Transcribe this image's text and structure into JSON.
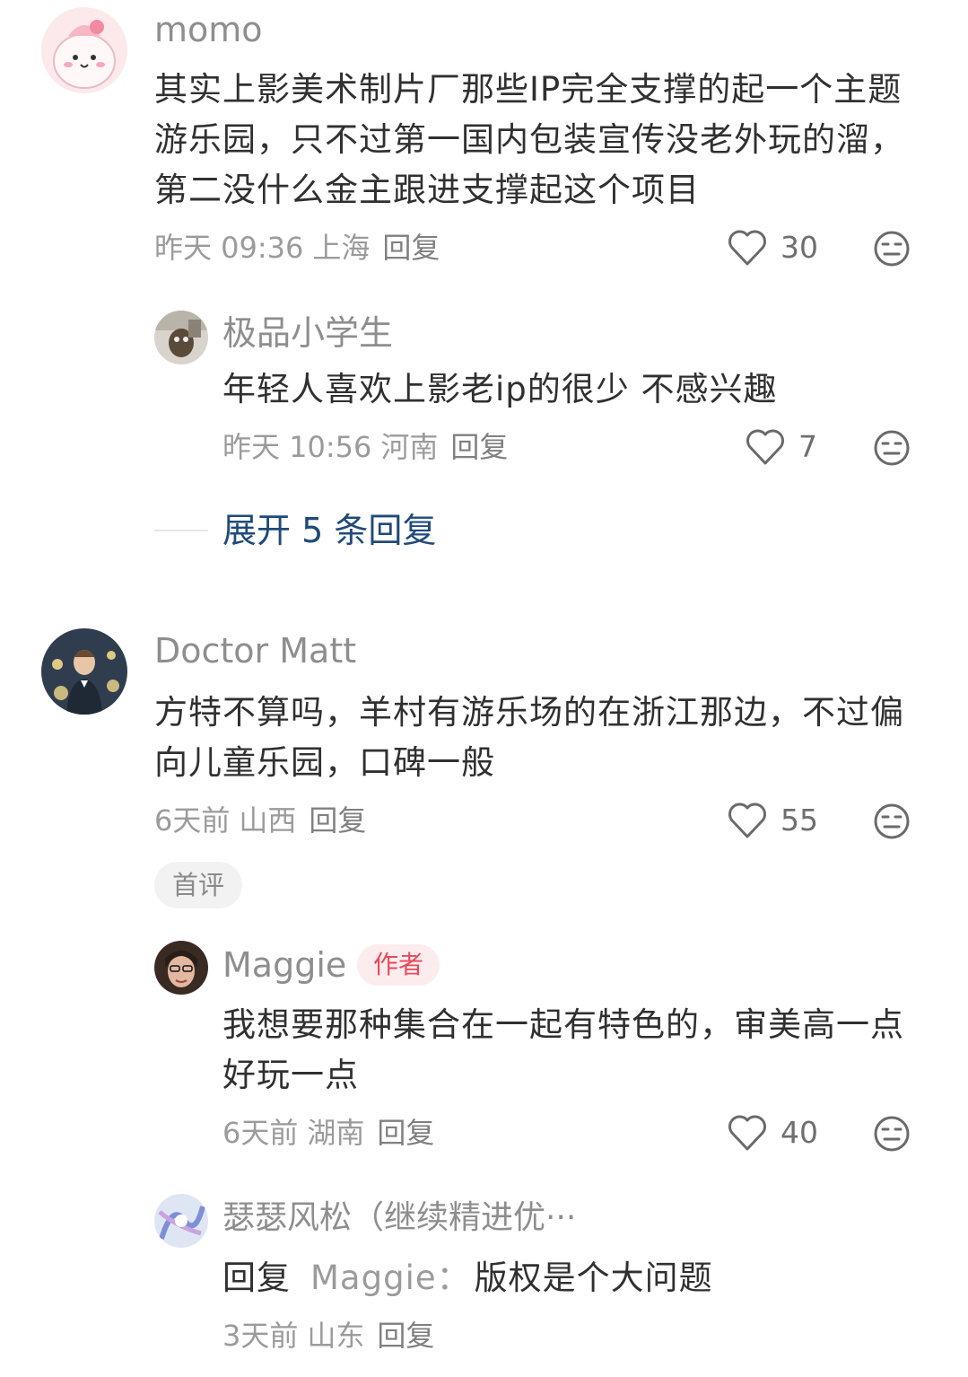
{
  "comments": [
    {
      "username": "momo",
      "text": "其实上影美术制片厂那些IP完全支撑的起一个主题游乐园，只不过第一国内包装宣传没老外玩的溜，第二没什么金主跟进支撑起这个项目",
      "time": "昨天 09:36",
      "location": "上海",
      "reply_label": "回复",
      "likes": "30",
      "replies": [
        {
          "username": "极品小学生",
          "text": "年轻人喜欢上影老ip的很少 不感兴趣",
          "time": "昨天 10:56",
          "location": "河南",
          "reply_label": "回复",
          "likes": "7"
        }
      ],
      "expand_label": "展开 5 条回复"
    },
    {
      "username": "Doctor Matt",
      "text": "方特不算吗，羊村有游乐场的在浙江那边，不过偏向儿童乐园，口碑一般",
      "time": "6天前",
      "location": "山西",
      "reply_label": "回复",
      "likes": "55",
      "tag": "首评",
      "replies": [
        {
          "username": "Maggie",
          "badge": "作者",
          "text": "我想要那种集合在一起有特色的，审美高一点好玩一点",
          "time": "6天前",
          "location": "湖南",
          "reply_label": "回复",
          "likes": "40"
        },
        {
          "username": "瑟瑟风松（继续精进优···",
          "reply_prefix": "回复",
          "reply_to": "Maggie：",
          "text": "版权是个大问题",
          "time": "3天前",
          "location": "山东",
          "reply_label": "回复"
        }
      ]
    }
  ],
  "icons": {
    "like": "heart-outline-icon",
    "dislike": "meh-face-icon"
  },
  "colors": {
    "link_blue": "#1f4a7a",
    "author_badge_red": "#e64a5c",
    "meta_gray": "#9b9b9b"
  }
}
